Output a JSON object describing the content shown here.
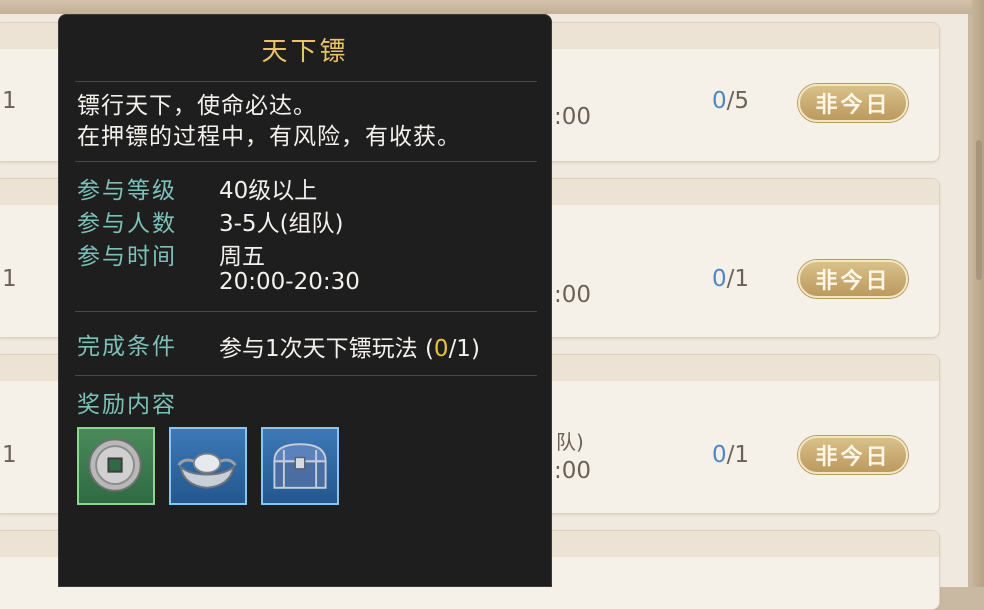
{
  "rows": [
    {
      "left": "1",
      "time": ":00",
      "team": "",
      "cur": "0",
      "total": "/5",
      "status": "非今日"
    },
    {
      "left": "1",
      "time": ":00",
      "team": "",
      "cur": "0",
      "total": "/1",
      "status": "非今日"
    },
    {
      "left": "1",
      "time": ":00",
      "team": "队)",
      "cur": "0",
      "total": "/1",
      "status": "非今日"
    }
  ],
  "tooltip": {
    "title": "天下镖",
    "desc_line1": "镖行天下，使命必达。",
    "desc_line2": "在押镖的过程中，有风险，有收获。",
    "level_label": "参与等级",
    "level_value": "40级以上",
    "people_label": "参与人数",
    "people_value": "3-5人(组队)",
    "time_label": "参与时间",
    "time_day": "周五",
    "time_range": "20:00-20:30",
    "complete_label": "完成条件",
    "complete_value": "参与1次天下镖玩法 (",
    "complete_cur": "0",
    "complete_end": "/1)",
    "reward_label": "奖励内容",
    "rewards": [
      {
        "icon": "copper-coin-icon"
      },
      {
        "icon": "silver-ingot-icon"
      },
      {
        "icon": "treasure-chest-icon"
      }
    ]
  },
  "colors": {
    "accent_gold": "#e7c36a",
    "label_teal": "#7cc1b9",
    "progress_blue": "#4f86c6",
    "highlight_yellow": "#e9c13e"
  }
}
